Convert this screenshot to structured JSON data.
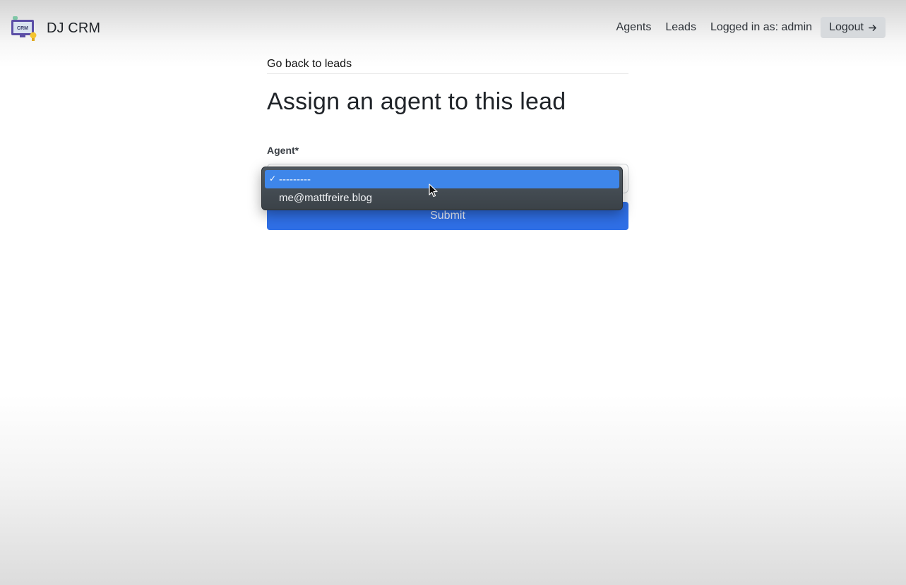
{
  "header": {
    "brand_name": "DJ CRM",
    "logo_text": "CRM",
    "nav": {
      "agents_label": "Agents",
      "leads_label": "Leads",
      "logged_in_text": "Logged in as: admin",
      "logout_label": "Logout"
    }
  },
  "main": {
    "back_link": "Go back to leads",
    "title": "Assign an agent to this lead",
    "agent_label": "Agent*",
    "submit_label": "Submit"
  },
  "dropdown": {
    "check_mark": "✓",
    "options": [
      {
        "label": "---------",
        "selected": true
      },
      {
        "label": "me@mattfreire.blog",
        "selected": false
      }
    ]
  },
  "colors": {
    "primary": "#2f6fe6",
    "dropdown_highlight": "#3e86ea",
    "dropdown_bg": "#464e56",
    "logout_bg": "#d7dadd"
  },
  "icons": {
    "logo": "crm-monitor-bulb-icon",
    "logout": "arrow-right-icon",
    "cursor": "mouse-pointer-icon",
    "check": "checkmark-icon"
  }
}
